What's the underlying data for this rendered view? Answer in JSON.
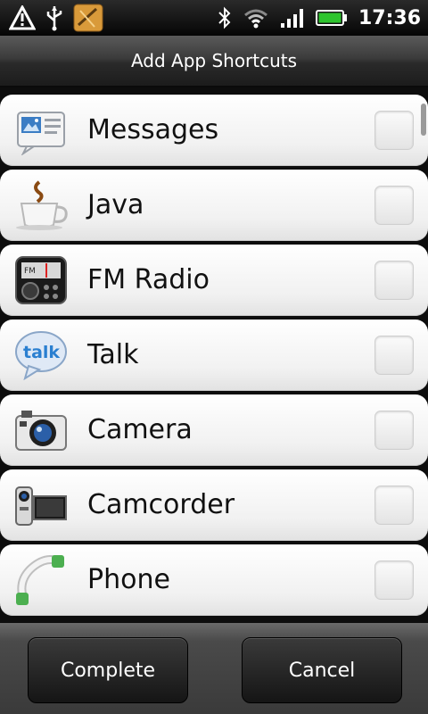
{
  "status_bar": {
    "time": "17:36",
    "icons": [
      "warning-icon",
      "usb-icon",
      "app-notification-icon",
      "bluetooth-icon",
      "wifi-icon",
      "signal-icon",
      "battery-icon"
    ]
  },
  "dialog": {
    "title": "Add App Shortcuts"
  },
  "items": [
    {
      "label": "Messages",
      "icon": "messages-icon",
      "checked": false
    },
    {
      "label": "Java",
      "icon": "java-icon",
      "checked": false
    },
    {
      "label": "FM Radio",
      "icon": "fm-radio-icon",
      "checked": false
    },
    {
      "label": "Talk",
      "icon": "talk-icon",
      "checked": false
    },
    {
      "label": "Camera",
      "icon": "camera-icon",
      "checked": false
    },
    {
      "label": "Camcorder",
      "icon": "camcorder-icon",
      "checked": false
    },
    {
      "label": "Phone",
      "icon": "phone-icon",
      "checked": false
    }
  ],
  "buttons": {
    "complete": "Complete",
    "cancel": "Cancel"
  },
  "colors": {
    "battery": "#2ec42e",
    "talk_bubble": "#2a7fd0",
    "phone_handset": "#4caf50"
  }
}
